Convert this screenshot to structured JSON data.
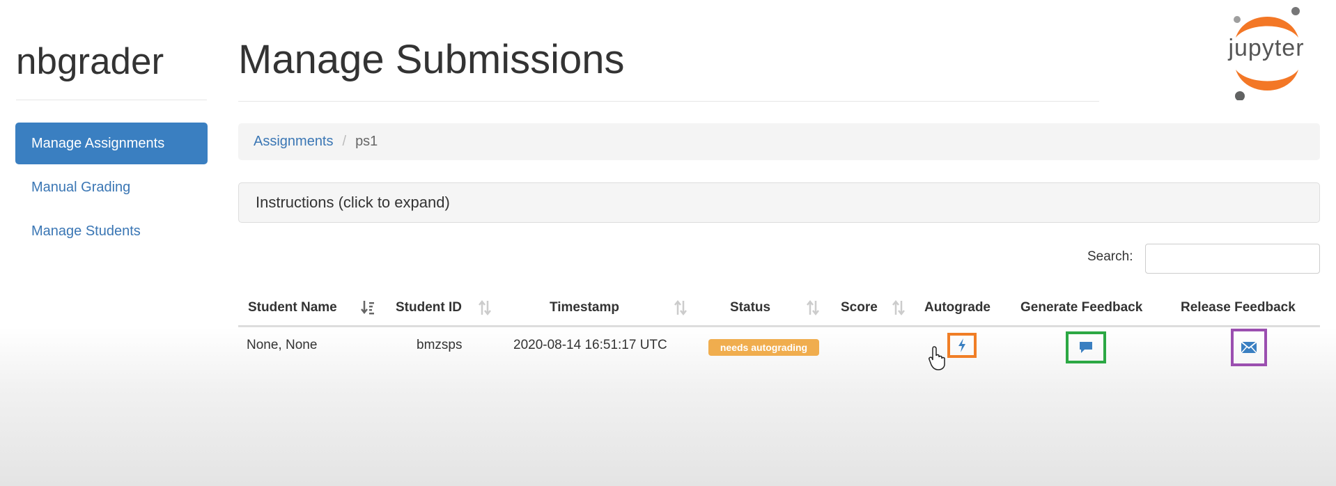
{
  "sidebar": {
    "app_title": "nbgrader",
    "items": [
      {
        "label": "Manage Assignments",
        "active": true
      },
      {
        "label": "Manual Grading",
        "active": false
      },
      {
        "label": "Manage Students",
        "active": false
      }
    ]
  },
  "header": {
    "title": "Manage Submissions",
    "logo_text": "jupyter"
  },
  "breadcrumb": {
    "items": [
      "Assignments",
      "ps1"
    ],
    "separator": "/"
  },
  "instructions": {
    "label": "Instructions (click to expand)"
  },
  "search": {
    "label": "Search:",
    "value": ""
  },
  "table": {
    "columns": [
      "Student Name",
      "Student ID",
      "Timestamp",
      "Status",
      "Score",
      "Autograde",
      "Generate Feedback",
      "Release Feedback"
    ],
    "rows": [
      {
        "student_name": "None, None",
        "student_id": "bmzsps",
        "timestamp": "2020-08-14 16:51:17 UTC",
        "status": "needs autograding",
        "score": ""
      }
    ]
  },
  "colors": {
    "accent": "#3a7fc1",
    "link": "#3a76b4",
    "status_badge": "#f0ad4e",
    "autograde_highlight": "#f07e26",
    "feedback_highlight": "#2ca844",
    "release_highlight": "#9b4fb0"
  },
  "icons": {
    "autograde": "bolt-icon",
    "generate_feedback": "comment-icon",
    "release_feedback": "envelope-icon"
  }
}
